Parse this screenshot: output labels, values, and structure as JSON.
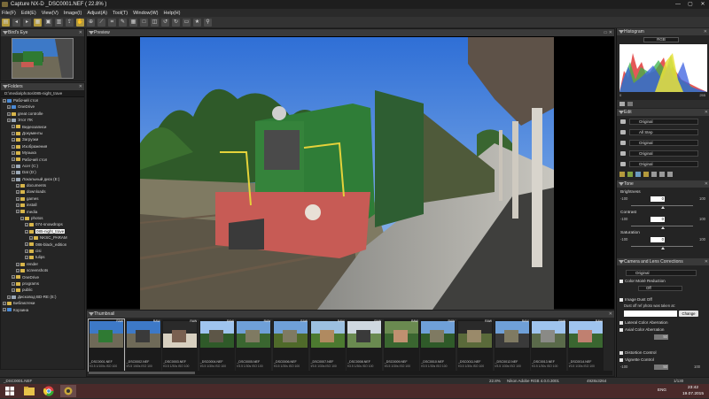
{
  "window": {
    "title": "Capture NX-D    _DSC0001.NEF ( 22.8% )",
    "controls": [
      "—",
      "▢",
      "✕"
    ]
  },
  "menu": [
    "File(F)",
    "Edit(E)",
    "View(V)",
    "Image(I)",
    "Adjust(A)",
    "Tool(T)",
    "Window(W)",
    "Help(H)"
  ],
  "panels": {
    "birdseye_title": "Bird's Eye",
    "folders_title": "Folders",
    "preview_title": "Preview",
    "thumbnail_title": "Thumbnail",
    "histogram_title": "Histogram",
    "edit_title": "Edit",
    "tone_title": "Tone",
    "camera_title": "Camera and Lens Corrections"
  },
  "folders": {
    "path": "D:\\media\\photos\\085-night_trave",
    "items": [
      {
        "label": "Рабочий стол",
        "depth": 0,
        "icon": "blue"
      },
      {
        "label": "OneDrive",
        "depth": 1,
        "icon": "blue"
      },
      {
        "label": "great controlle",
        "depth": 1,
        "icon": "folder"
      },
      {
        "label": "Этот ПК",
        "depth": 1,
        "icon": "drive"
      },
      {
        "label": "Видеозаписи",
        "depth": 2,
        "icon": "folder"
      },
      {
        "label": "Документы",
        "depth": 2,
        "icon": "folder"
      },
      {
        "label": "Загрузки",
        "depth": 2,
        "icon": "folder"
      },
      {
        "label": "Изображения",
        "depth": 2,
        "icon": "folder"
      },
      {
        "label": "Музыка",
        "depth": 2,
        "icon": "folder"
      },
      {
        "label": "Рабочий стол",
        "depth": 2,
        "icon": "folder"
      },
      {
        "label": "Acer (C:)",
        "depth": 2,
        "icon": "drive"
      },
      {
        "label": "Dat (D:)",
        "depth": 2,
        "icon": "drive"
      },
      {
        "label": "Локальный диск (E:)",
        "depth": 2,
        "icon": "drive"
      },
      {
        "label": "documents",
        "depth": 3,
        "icon": "folder"
      },
      {
        "label": "downloads",
        "depth": 3,
        "icon": "folder"
      },
      {
        "label": "games",
        "depth": 3,
        "icon": "folder"
      },
      {
        "label": "install",
        "depth": 3,
        "icon": "folder"
      },
      {
        "label": "media",
        "depth": 3,
        "icon": "folder"
      },
      {
        "label": "photos",
        "depth": 4,
        "icon": "folder"
      },
      {
        "label": "074-snowdrops",
        "depth": 5,
        "icon": "folder"
      },
      {
        "label": "085-night_trave",
        "depth": 5,
        "icon": "folder",
        "selected": true
      },
      {
        "label": "NKSC_PARAM",
        "depth": 6,
        "icon": "folder"
      },
      {
        "label": "086-black_edition",
        "depth": 5,
        "icon": "folder"
      },
      {
        "label": "cisi",
        "depth": 5,
        "icon": "folder"
      },
      {
        "label": "tulips",
        "depth": 5,
        "icon": "folder"
      },
      {
        "label": "render",
        "depth": 3,
        "icon": "folder"
      },
      {
        "label": "screenshots",
        "depth": 3,
        "icon": "folder"
      },
      {
        "label": "OneDrive",
        "depth": 2,
        "icon": "folder"
      },
      {
        "label": "programs",
        "depth": 2,
        "icon": "folder"
      },
      {
        "label": "public",
        "depth": 2,
        "icon": "folder"
      },
      {
        "label": "Дисковод BD-RE (E:)",
        "depth": 1,
        "icon": "drive"
      },
      {
        "label": "Библиотеки",
        "depth": 0,
        "icon": "folder"
      },
      {
        "label": "Корзина",
        "depth": 0,
        "icon": "blue"
      }
    ]
  },
  "thumbnails": [
    {
      "name": "_DSC0001.NEF",
      "info": "f/3.5 1/100s ISO 100",
      "selected": true
    },
    {
      "name": "_DSC0002.NEF",
      "info": "f/3.5 1/60s ISO 100"
    },
    {
      "name": "_DSC0003.NEF",
      "info": "f/3.5 1/30s ISO 100"
    },
    {
      "name": "_DSC0004.NEF",
      "info": "f/3.5 1/30s ISO 100"
    },
    {
      "name": "_DSC0005.NEF",
      "info": "f/3.5 1/30s ISO 100"
    },
    {
      "name": "_DSC0006.NEF",
      "info": "f/3.5 1/30s ISO 100"
    },
    {
      "name": "_DSC0007.NEF",
      "info": "f/3.5 1/30s ISO 100"
    },
    {
      "name": "_DSC0008.NEF",
      "info": "f/3.5 1/30s ISO 100"
    },
    {
      "name": "_DSC0009.NEF",
      "info": "f/3.5 1/30s ISO 100"
    },
    {
      "name": "_DSC0010.NEF",
      "info": "f/3.5 1/30s ISO 100"
    },
    {
      "name": "_DSC0011.NEF",
      "info": "f/3.5 1/30s ISO 100"
    },
    {
      "name": "_DSC0012.NEF",
      "info": "f/3.5 1/30s ISO 100"
    },
    {
      "name": "_DSC0013.NEF",
      "info": "f/3.5 1/30s ISO 100"
    },
    {
      "name": "_DSC0014.NEF",
      "info": "f/3.5 1/30s ISO 100"
    }
  ],
  "thumb_badge": "RAW",
  "histogram": {
    "channel": "RGB",
    "min": "0",
    "max": "255"
  },
  "edit": {
    "rows": [
      "Original",
      "All Step",
      "Original",
      "Original",
      "Original"
    ]
  },
  "tone": {
    "brightness_label": "Brightness",
    "brightness_value": "0",
    "contrast_label": "Contrast",
    "contrast_value": "0",
    "saturation_label": "Saturation",
    "saturation_value": "0",
    "min": "-100",
    "max": "100"
  },
  "camera": {
    "preset": "Original",
    "color_moire": "Color Moiré Reduction",
    "color_moire_value": "Off",
    "image_dust_off": "Image Dust Off",
    "dust_off_label": "Dust off ref photo was taken at:",
    "change_button": "Change",
    "lateral_ca": "Lateral Color Aberration",
    "axial_ca": "Axial Color Aberration",
    "axial_value": "50",
    "distortion": "Distortion Control",
    "vignette": "Vignette Control",
    "vignette_value": "50",
    "vignette_min": "-100",
    "vignette_max": "100"
  },
  "statusbar": {
    "file": "_DSC0001.NEF",
    "zoom": "22.8%",
    "profile": "Nikon Adobe RGB 4.0.0.3001",
    "size": "4928x3264",
    "page": "1/130"
  },
  "taskbar": {
    "time": "23:42",
    "date": "19.07.2015",
    "lang": "ENG"
  }
}
